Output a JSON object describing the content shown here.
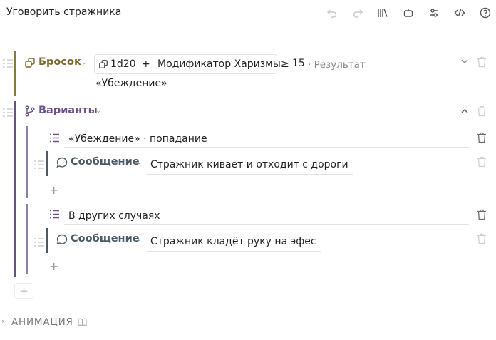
{
  "header": {
    "title": "Уговорить стражника"
  },
  "roll": {
    "keyword": "Бросок",
    "dice": "1d20",
    "plus": "+",
    "modifier": "Модификатор Харизмы",
    "comparator": "≥",
    "target": "15",
    "result_label": "· Результат",
    "result_value": "«Убеждение»"
  },
  "variants": {
    "keyword": "Варианты",
    "branches": [
      {
        "condition": "«Убеждение» · попадание",
        "action_keyword": "Сообщение",
        "message": "Стражник кивает и отходит с дороги",
        "add": "+"
      },
      {
        "condition": "В других случаях",
        "action_keyword": "Сообщение",
        "message": "Стражник кладёт руку на эфес",
        "add": "+"
      }
    ]
  },
  "root_add": "+",
  "animation": {
    "label": "АНИМАЦИЯ"
  },
  "colors": {
    "roll_accent": "#7a6a2a",
    "variants_accent": "#6b4f8a",
    "message_accent": "#4a5a66"
  }
}
